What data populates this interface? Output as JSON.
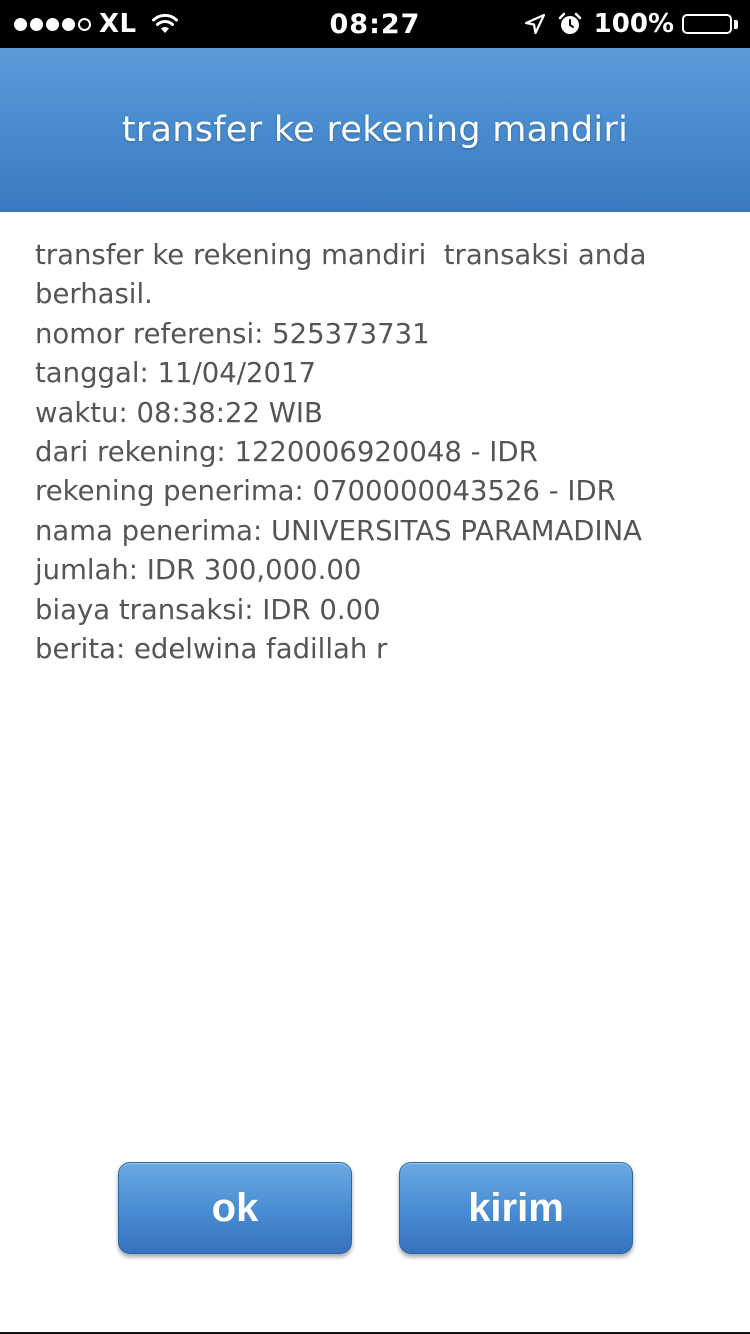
{
  "status_bar": {
    "carrier": "XL",
    "time": "08:27",
    "battery": "100%",
    "signal_bars_filled": 4,
    "signal_bars_total": 5,
    "icons": [
      "wifi-icon",
      "location-arrow-icon",
      "alarm-clock-icon",
      "battery-icon"
    ]
  },
  "header": {
    "title": "transfer ke rekening mandiri",
    "color": "#4a8dcf"
  },
  "content": {
    "lines": [
      "transfer ke rekening mandiri  transaksi anda",
      "berhasil.",
      "nomor referensi: 525373731",
      "tanggal: 11/04/2017",
      "waktu: 08:38:22 WIB",
      "dari rekening: 1220006920048 - IDR",
      "rekening penerima: 0700000043526 - IDR",
      "nama penerima: UNIVERSITAS PARAMADINA",
      "jumlah: IDR 300,000.00",
      "biaya transaksi: IDR 0.00",
      "berita: edelwina fadillah r"
    ],
    "text_color": "#555555"
  },
  "buttons": {
    "ok_label": "ok",
    "kirim_label": "kirim",
    "color": "#4a8ed3"
  }
}
